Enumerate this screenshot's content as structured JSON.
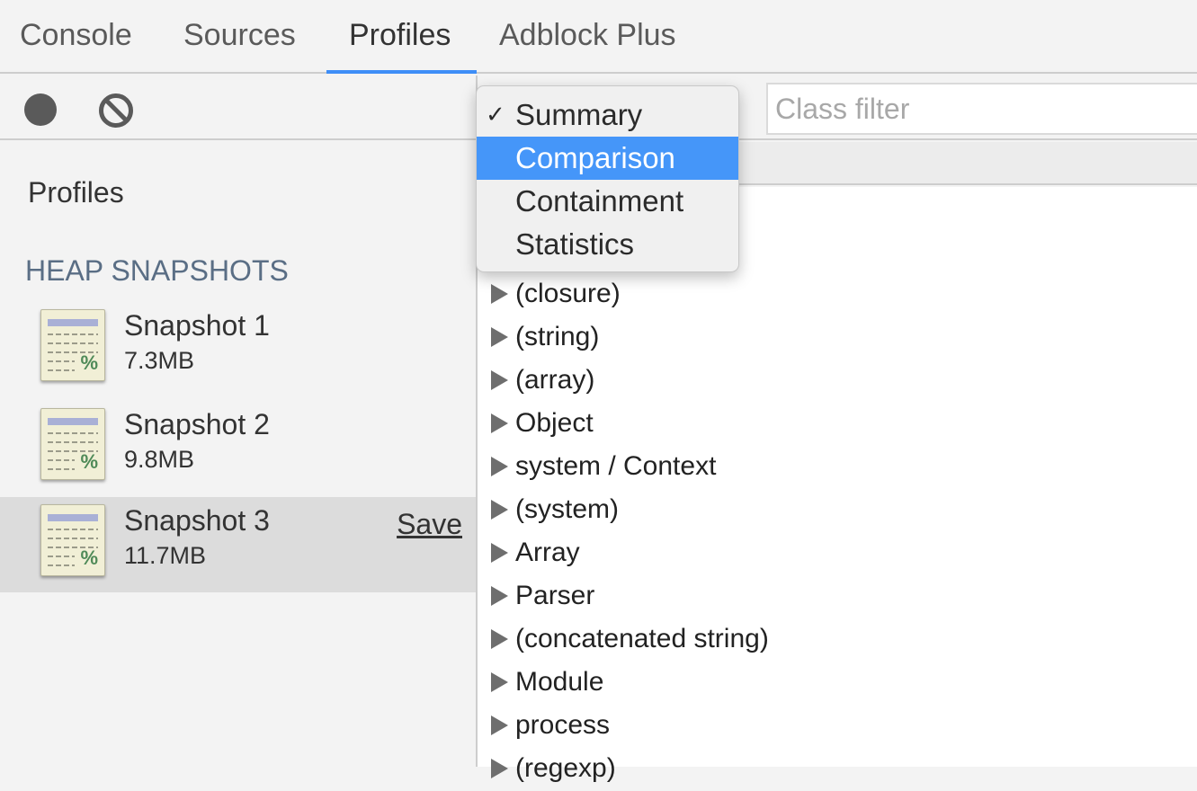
{
  "tabs": [
    {
      "label": "Console"
    },
    {
      "label": "Sources"
    },
    {
      "label": "Profiles",
      "active": true
    },
    {
      "label": "Adblock Plus"
    }
  ],
  "accent": "#3e8ef7",
  "toolbar": {
    "record_icon": "record-icon",
    "clear_icon": "clear-icon"
  },
  "sidebar": {
    "title": "Profiles",
    "section": "HEAP SNAPSHOTS",
    "snapshots": [
      {
        "name": "Snapshot 1",
        "size": "7.3MB"
      },
      {
        "name": "Snapshot 2",
        "size": "9.8MB"
      },
      {
        "name": "Snapshot 3",
        "size": "11.7MB",
        "selected": true,
        "action": "Save"
      }
    ]
  },
  "main": {
    "filter_placeholder": "Class filter",
    "view_menu": {
      "checkmark": "✓",
      "options": [
        "Summary",
        "Comparison",
        "Containment",
        "Statistics"
      ],
      "selected": "Summary",
      "highlighted": "Comparison"
    },
    "rows": [
      "(closure)",
      "(string)",
      "(array)",
      "Object",
      "system / Context",
      "(system)",
      "Array",
      "Parser",
      "(concatenated string)",
      "Module",
      "process",
      "(regexp)"
    ]
  }
}
